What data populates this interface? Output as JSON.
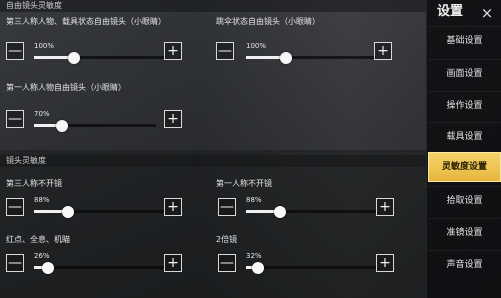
{
  "header": {
    "partial_title": "自由镜头灵敏度"
  },
  "sections": [
    {
      "sliders": [
        {
          "label": "第三人称人物、载具状态自由镜头（小眼睛）",
          "value_text": "100%",
          "percent": 100
        },
        {
          "label": "跳伞状态自由镜头（小眼睛）",
          "value_text": "100%",
          "percent": 100
        },
        {
          "label": "第一人称人物自由镜头（小眼睛）",
          "value_text": "70%",
          "percent": 70
        }
      ]
    },
    {
      "title": "镜头灵敏度",
      "sliders": [
        {
          "label": "第三人称不开镜",
          "value_text": "88%",
          "percent": 88
        },
        {
          "label": "第一人称不开镜",
          "value_text": "88%",
          "percent": 88
        },
        {
          "label": "红点、全息、机瞄",
          "value_text": "26%",
          "percent": 26
        },
        {
          "label": "2倍镜",
          "value_text": "32%",
          "percent": 32
        }
      ]
    }
  ],
  "buttons": {
    "minus": "—",
    "plus": "+"
  },
  "sidebar": {
    "title": "设置",
    "close": "×",
    "items": [
      {
        "label": "基础设置",
        "active": false
      },
      {
        "label": "画面设置",
        "active": false
      },
      {
        "label": "操作设置",
        "active": false
      },
      {
        "label": "载具设置",
        "active": false
      },
      {
        "label": "灵敏度设置",
        "active": true
      },
      {
        "label": "拾取设置",
        "active": false
      },
      {
        "label": "准镜设置",
        "active": false
      },
      {
        "label": "声音设置",
        "active": false
      }
    ]
  },
  "colors": {
    "accent": "#f0c24e",
    "panel": "#0c0d0f"
  }
}
